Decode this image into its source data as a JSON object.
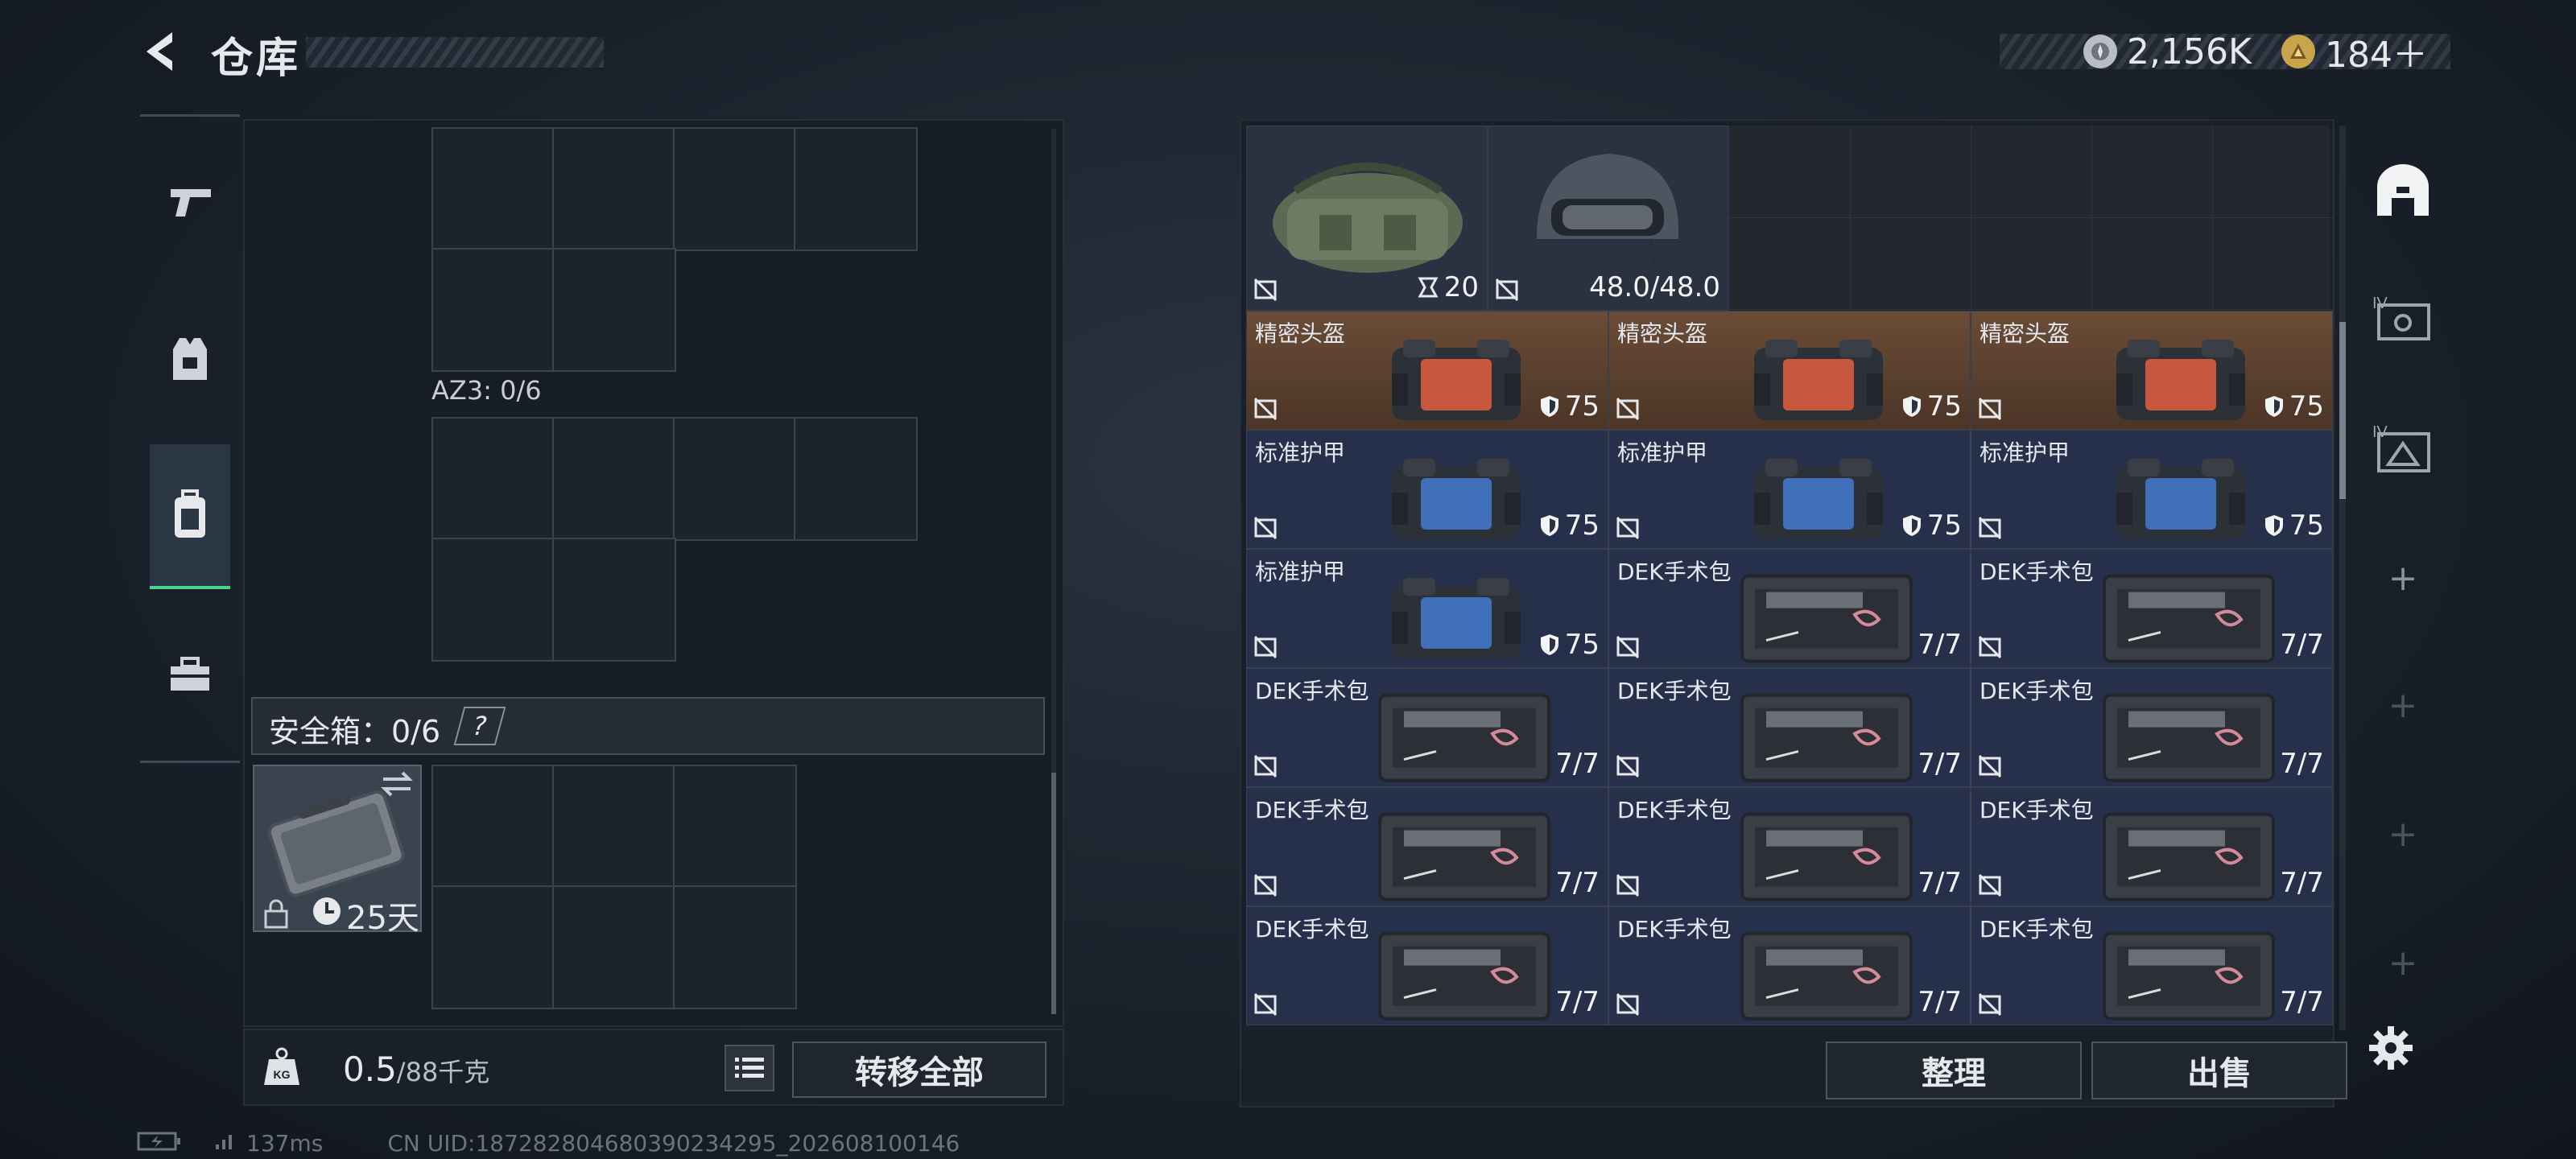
{
  "header": {
    "title": "仓库"
  },
  "currency": [
    {
      "icon": "silver-coin-icon",
      "value": "2,156K",
      "color": "#c9ccd2"
    },
    {
      "icon": "gold-coin-icon",
      "value": "184＋",
      "color": "#c9a44c"
    }
  ],
  "tabs": [
    {
      "name": "weapons",
      "icon": "pistol-icon",
      "active": false
    },
    {
      "name": "armor",
      "icon": "vest-icon",
      "active": false
    },
    {
      "name": "backpack",
      "icon": "backpack-icon",
      "active": true
    },
    {
      "name": "tools",
      "icon": "toolbox-icon",
      "active": false
    }
  ],
  "left": {
    "az3_label": "AZ3: 0/6",
    "safebox_label": "安全箱：0/6",
    "safebox_help": "?",
    "safebox_days": "25天",
    "weight_value": "0.5",
    "weight_unit": "/88千克",
    "transfer_all": "转移全部"
  },
  "right": {
    "top_items": [
      {
        "name": "duffel-bag",
        "value": "20"
      },
      {
        "name": "helmet",
        "value": "48.0/48.0"
      }
    ],
    "rows": [
      [
        {
          "name": "精密头盔",
          "val": "75",
          "type": "shield",
          "bg": "brown"
        },
        {
          "name": "精密头盔",
          "val": "75",
          "type": "shield",
          "bg": "brown"
        },
        {
          "name": "精密头盔",
          "val": "75",
          "type": "shield",
          "bg": "brown"
        }
      ],
      [
        {
          "name": "标准护甲",
          "val": "75",
          "type": "shield",
          "bg": "blue"
        },
        {
          "name": "标准护甲",
          "val": "75",
          "type": "shield",
          "bg": "blue"
        },
        {
          "name": "标准护甲",
          "val": "75",
          "type": "shield",
          "bg": "blue"
        }
      ],
      [
        {
          "name": "标准护甲",
          "val": "75",
          "type": "shield",
          "bg": "blue"
        },
        {
          "name": "DEK手术包",
          "val": "7/7",
          "type": "kit",
          "bg": "blue"
        },
        {
          "name": "DEK手术包",
          "val": "7/7",
          "type": "kit",
          "bg": "blue"
        }
      ],
      [
        {
          "name": "DEK手术包",
          "val": "7/7",
          "type": "kit",
          "bg": "blue"
        },
        {
          "name": "DEK手术包",
          "val": "7/7",
          "type": "kit",
          "bg": "blue"
        },
        {
          "name": "DEK手术包",
          "val": "7/7",
          "type": "kit",
          "bg": "blue"
        }
      ],
      [
        {
          "name": "DEK手术包",
          "val": "7/7",
          "type": "kit",
          "bg": "blue"
        },
        {
          "name": "DEK手术包",
          "val": "7/7",
          "type": "kit",
          "bg": "blue"
        },
        {
          "name": "DEK手术包",
          "val": "7/7",
          "type": "kit",
          "bg": "blue"
        }
      ],
      [
        {
          "name": "DEK手术包",
          "val": "7/7",
          "type": "kit",
          "bg": "blue"
        },
        {
          "name": "DEK手术包",
          "val": "7/7",
          "type": "kit",
          "bg": "blue"
        },
        {
          "name": "DEK手术包",
          "val": "7/7",
          "type": "kit",
          "bg": "blue"
        }
      ]
    ],
    "sort_button": "整理",
    "sell_button": "出售"
  },
  "footer": {
    "ping": "137ms",
    "uid": "CN UID:187282804680390234295_202608100146"
  }
}
